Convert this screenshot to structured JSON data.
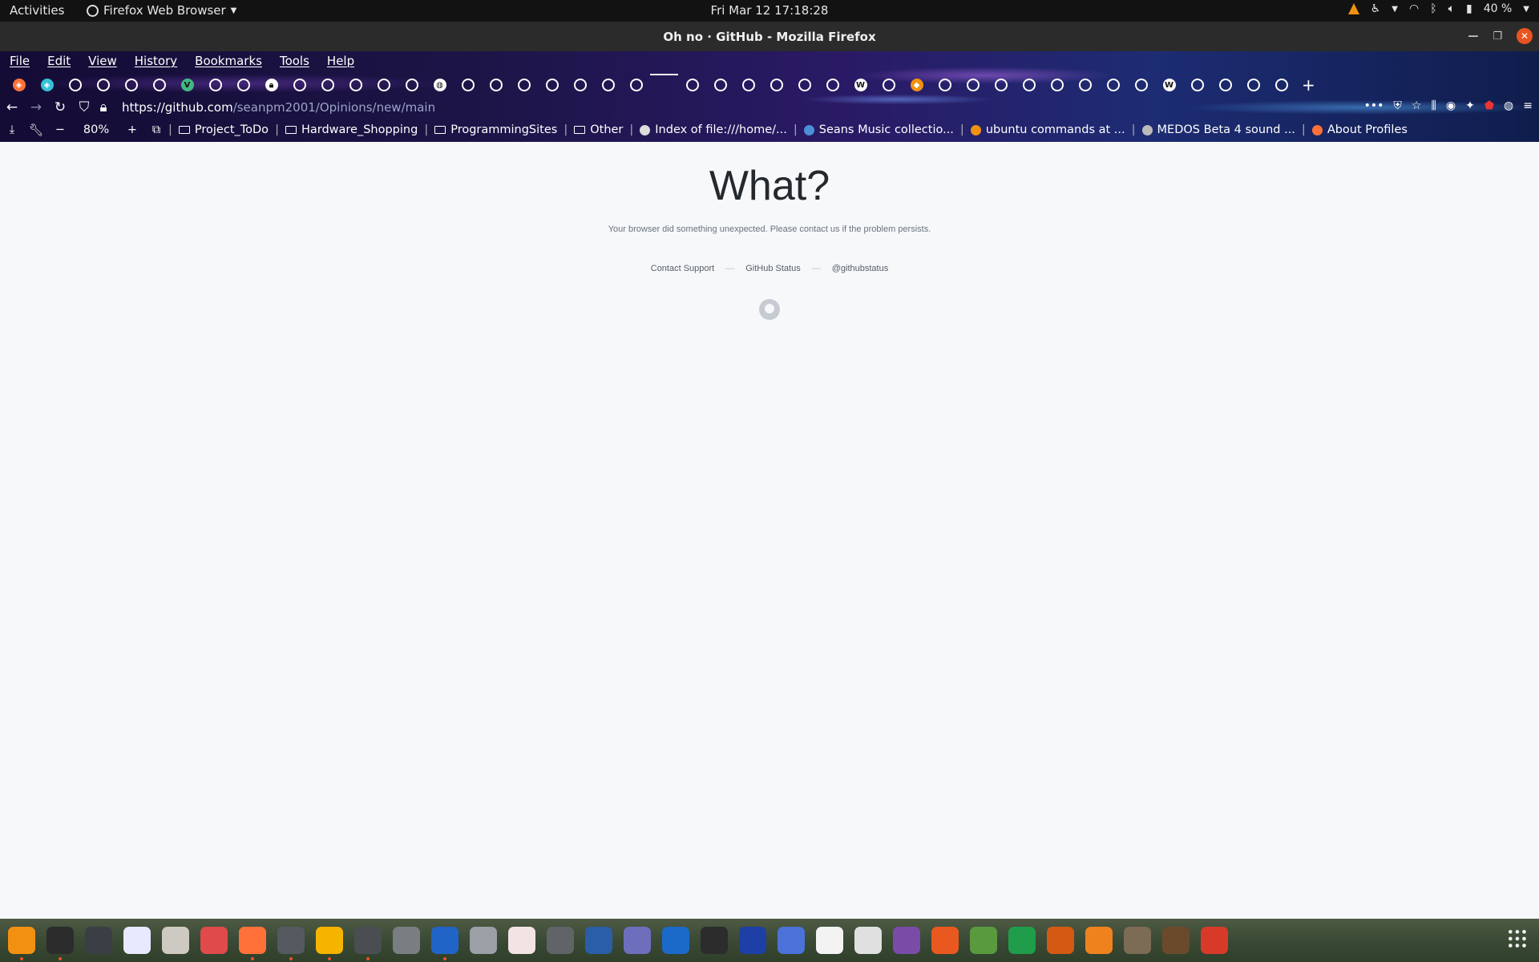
{
  "topbar": {
    "activities": "Activities",
    "app_name": "Firefox Web Browser",
    "clock": "Fri Mar 12  17:18:28",
    "battery": "40 %"
  },
  "window": {
    "title": "Oh no · GitHub - Mozilla Firefox"
  },
  "menu": [
    "File",
    "Edit",
    "View",
    "History",
    "Bookmarks",
    "Tools",
    "Help"
  ],
  "tabs": [
    "generic",
    "generic",
    "gh",
    "gh",
    "gh",
    "gh",
    "vue",
    "gh",
    "gh",
    "lock",
    "gh",
    "gh",
    "gh",
    "gh",
    "gh",
    "globe",
    "gh",
    "gh",
    "gh",
    "gh",
    "gh",
    "gh",
    "gh",
    "active",
    "gh",
    "gh",
    "gh",
    "gh",
    "gh",
    "gh",
    "w",
    "gh",
    "orange",
    "gh",
    "gh",
    "gh",
    "gh",
    "gh",
    "gh",
    "gh",
    "gh",
    "w",
    "gh",
    "gh",
    "gh",
    "gh"
  ],
  "navbar": {
    "url_host": "https://github.com",
    "url_path": "/seanpm2001/Opinions/new/main"
  },
  "toolbar": {
    "zoom": "80%"
  },
  "bookmarks": [
    {
      "label": "Project_ToDo",
      "icon": "folder-icon"
    },
    {
      "label": "Hardware_Shopping",
      "icon": "folder-icon"
    },
    {
      "label": "ProgrammingSites",
      "icon": "folder-icon"
    },
    {
      "label": "Other",
      "icon": "folder-icon"
    },
    {
      "label": "Index of file:///home/...",
      "icon": "page-icon"
    },
    {
      "label": "Seans Music collectio...",
      "icon": "globe-icon"
    },
    {
      "label": "ubuntu commands at ...",
      "icon": "site-icon"
    },
    {
      "label": "MEDOS Beta 4 sound ...",
      "icon": "image-icon"
    },
    {
      "label": "About Profiles",
      "icon": "firefox-icon"
    }
  ],
  "page": {
    "heading": "What?",
    "message": "Your browser did something unexpected. Please contact us if the problem persists.",
    "links": [
      "Contact Support",
      "GitHub Status",
      "@githubstatus"
    ]
  },
  "dock": [
    {
      "name": "vlc",
      "color": "#f29111",
      "running": true
    },
    {
      "name": "terminal",
      "color": "#2c2c2c",
      "running": true
    },
    {
      "name": "system-monitor",
      "color": "#3b3f45",
      "running": false
    },
    {
      "name": "text-editor",
      "color": "#e8e8ff",
      "running": false
    },
    {
      "name": "files",
      "color": "#cfcac1",
      "running": false
    },
    {
      "name": "disk-usage",
      "color": "#e04a4a",
      "running": false
    },
    {
      "name": "firefox",
      "color": "#ff7139",
      "running": true
    },
    {
      "name": "clocks",
      "color": "#555a60",
      "running": true
    },
    {
      "name": "calculator",
      "color": "#f5b400",
      "running": true
    },
    {
      "name": "extensions",
      "color": "#4a4e52",
      "running": true
    },
    {
      "name": "settings",
      "color": "#7a7e83",
      "running": false
    },
    {
      "name": "writer",
      "color": "#1f64c6",
      "running": true
    },
    {
      "name": "image-viewer",
      "color": "#9aa0a6",
      "running": false
    },
    {
      "name": "oscilloscope",
      "color": "#f2e4e4",
      "running": false
    },
    {
      "name": "software",
      "color": "#606468",
      "running": false
    },
    {
      "name": "inkscape",
      "color": "#2a5ea8",
      "running": false
    },
    {
      "name": "screenshot",
      "color": "#6d6fbd",
      "running": false
    },
    {
      "name": "virtualbox",
      "color": "#1b6ac9",
      "running": false
    },
    {
      "name": "godot",
      "color": "#2c2c2c",
      "running": false
    },
    {
      "name": "audio",
      "color": "#1d3fa6",
      "running": false
    },
    {
      "name": "screen-select",
      "color": "#4b72d8",
      "running": false
    },
    {
      "name": "character-map",
      "color": "#f3f3f3",
      "running": false
    },
    {
      "name": "typography",
      "color": "#e0e0e0",
      "running": false
    },
    {
      "name": "tweaks",
      "color": "#7a4ca8",
      "running": false
    },
    {
      "name": "ubuntu-software",
      "color": "#e9581e",
      "running": false
    },
    {
      "name": "draw",
      "color": "#5a9a3e",
      "running": false
    },
    {
      "name": "calc",
      "color": "#1f9d4a",
      "running": false
    },
    {
      "name": "impress",
      "color": "#d45a14",
      "running": false
    },
    {
      "name": "blender",
      "color": "#f0821e",
      "running": false
    },
    {
      "name": "gimp",
      "color": "#7c6b55",
      "running": false
    },
    {
      "name": "minecraft",
      "color": "#6b4a2c",
      "running": false
    },
    {
      "name": "mario",
      "color": "#d83a2a",
      "running": false
    }
  ]
}
